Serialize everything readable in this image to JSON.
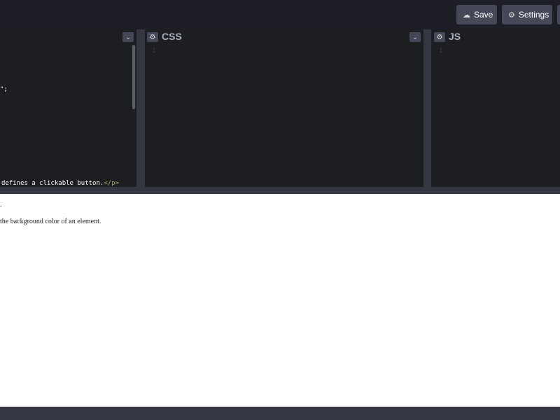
{
  "toolbar": {
    "save_label": "Save",
    "settings_label": "Settings"
  },
  "editors": {
    "html": {
      "lines": [
        "\";",
        "defines a clickable button.",
        "</p>"
      ]
    },
    "css": {
      "title": "CSS",
      "line_number": "1"
    },
    "js": {
      "title": "JS",
      "line_number": "1"
    }
  },
  "preview": {
    "line1": ".",
    "line2": "the background color of an element."
  },
  "colors": {
    "background": "#1e1f26",
    "button": "#444857",
    "editor_bg": "#1d1e22",
    "resizer": "#343641"
  }
}
